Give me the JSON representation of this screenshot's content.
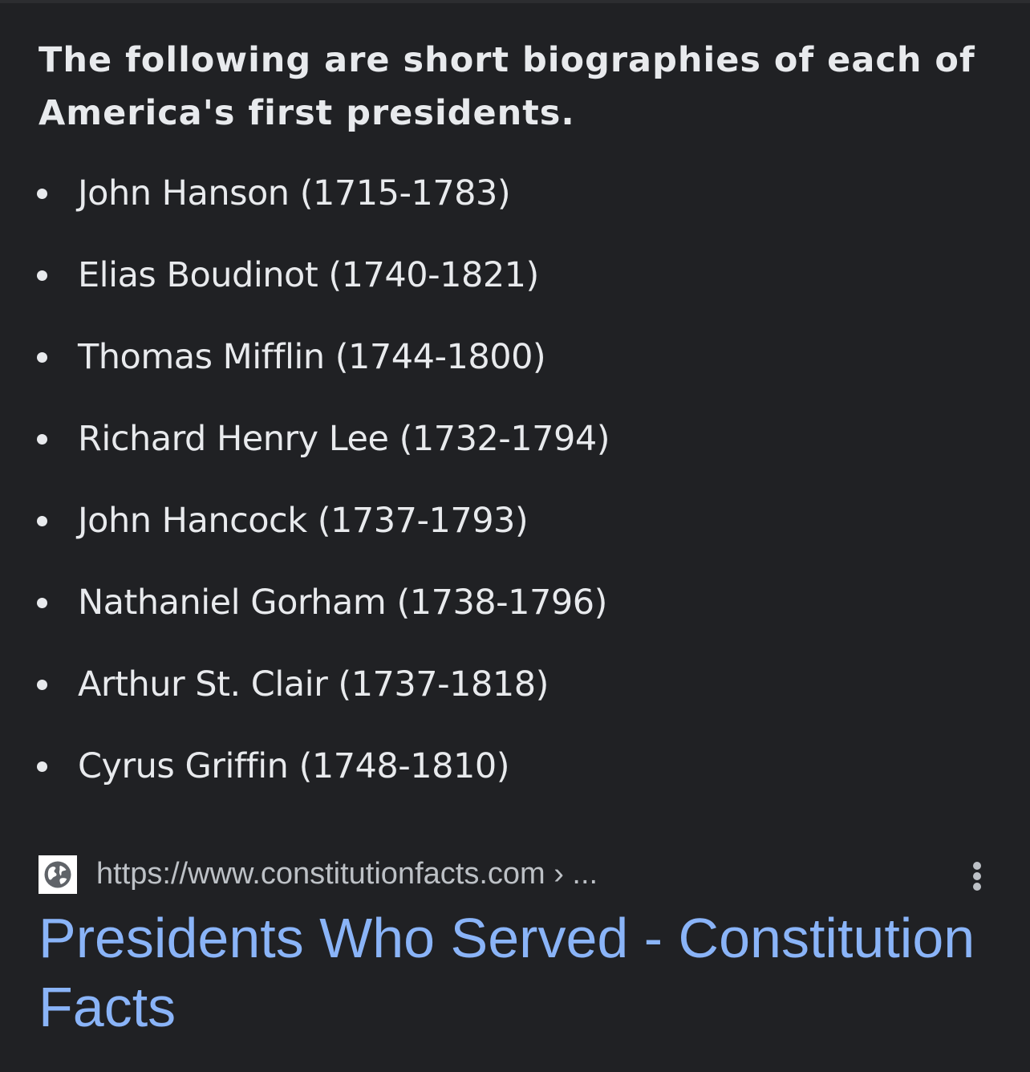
{
  "snippet": {
    "heading": "The following are short biographies of each of America's first presidents.",
    "items": [
      "John Hanson (1715-1783)",
      "Elias Boudinot (1740-1821)",
      "Thomas Mifflin (1744-1800)",
      "Richard Henry Lee (1732-1794)",
      "John Hancock (1737-1793)",
      "Nathaniel Gorham (1738-1796)",
      "Arthur St. Clair (1737-1818)",
      "Cyrus Griffin (1748-1810)"
    ]
  },
  "result": {
    "source_url": "https://www.constitutionfacts.com › ...",
    "favicon_icon": "globe-icon",
    "more_icon": "more-vert-icon",
    "title": "Presidents Who Served - Constitution Facts"
  },
  "colors": {
    "background": "#202124",
    "text": "#e8eaed",
    "secondary_text": "#bdc1c6",
    "link": "#8ab4f8"
  }
}
